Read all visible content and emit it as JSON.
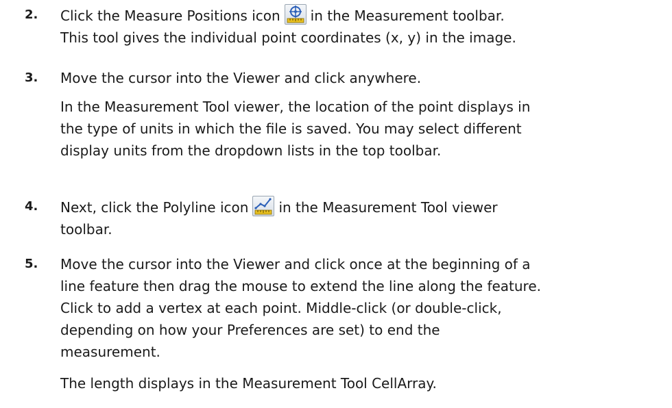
{
  "steps": [
    {
      "number": "2.",
      "text_before_icon": "Click the Measure Positions icon",
      "icon": "measure-positions-icon",
      "text_after_icon": "in the Measurement toolbar.",
      "lines_after": [
        "This tool gives the individual point coordinates (x, y) in the image."
      ]
    },
    {
      "number": "3.",
      "lines": [
        "Move the cursor into the Viewer and click anywhere."
      ],
      "note_lines": [
        "In the Measurement Tool viewer, the location of the point displays in",
        "the type of units in which the file is saved. You may select different",
        "display units from the dropdown lists in the top toolbar."
      ]
    },
    {
      "number": "4.",
      "text_before_icon": "Next, click the Polyline icon",
      "icon": "polyline-icon",
      "text_after_icon": "in the Measurement Tool viewer",
      "lines_after": [
        "toolbar."
      ]
    },
    {
      "number": "5.",
      "lines": [
        "Move the cursor into the Viewer and click once at the beginning of a",
        "line feature then drag the mouse to extend the line along the feature.",
        "Click to add a vertex at each point. Middle-click (or double-click,",
        "depending on how your Preferences are set) to end the",
        "measurement."
      ],
      "note_lines": [
        "The length displays in the Measurement Tool CellArray."
      ]
    }
  ],
  "colors": {
    "text": "#1a1a1a",
    "icon_blue": "#2b5fb8",
    "icon_ruler": "#e8c020"
  }
}
